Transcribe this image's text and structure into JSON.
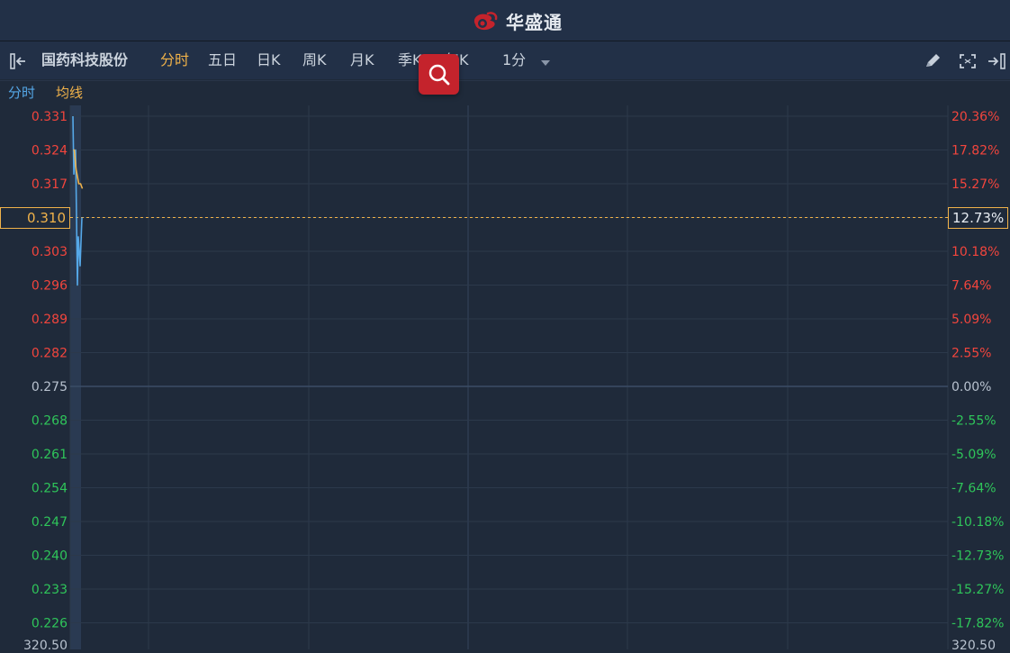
{
  "app": {
    "brand": "华盛通",
    "brand_color": "#c4232c"
  },
  "toolbar": {
    "stock_name": "国药科技股份",
    "tabs": [
      "分时",
      "五日",
      "日K",
      "周K",
      "月K",
      "季K",
      "年K"
    ],
    "active_tab": "分时",
    "interval": "1分",
    "icons": [
      "collapse-left-icon",
      "pencil-icon",
      "fullscreen-icon",
      "collapse-right-icon",
      "search-icon"
    ]
  },
  "legend": {
    "line1": "分时",
    "line2": "均线",
    "line1_color": "#55a8e8",
    "line2_color": "#f0b24a"
  },
  "chart_data": {
    "type": "line",
    "base_price": 0.275,
    "current_price": "0.310",
    "current_pct": "12.73%",
    "y_ticks": [
      {
        "price": "0.331",
        "pct": "20.36%",
        "dir": "up"
      },
      {
        "price": "0.324",
        "pct": "17.82%",
        "dir": "up"
      },
      {
        "price": "0.317",
        "pct": "15.27%",
        "dir": "up"
      },
      {
        "price": "0.310",
        "pct": "12.73%",
        "dir": "up"
      },
      {
        "price": "0.303",
        "pct": "10.18%",
        "dir": "up"
      },
      {
        "price": "0.296",
        "pct": "7.64%",
        "dir": "up"
      },
      {
        "price": "0.289",
        "pct": "5.09%",
        "dir": "up"
      },
      {
        "price": "0.282",
        "pct": "2.55%",
        "dir": "up"
      },
      {
        "price": "0.275",
        "pct": "0.00%",
        "dir": "flat"
      },
      {
        "price": "0.268",
        "pct": "-2.55%",
        "dir": "down"
      },
      {
        "price": "0.261",
        "pct": "-5.09%",
        "dir": "down"
      },
      {
        "price": "0.254",
        "pct": "-7.64%",
        "dir": "down"
      },
      {
        "price": "0.247",
        "pct": "-10.18%",
        "dir": "down"
      },
      {
        "price": "0.240",
        "pct": "-12.73%",
        "dir": "down"
      },
      {
        "price": "0.233",
        "pct": "-15.27%",
        "dir": "down"
      },
      {
        "price": "0.226",
        "pct": "-17.82%",
        "dir": "down"
      }
    ],
    "bottom_labels": {
      "left": "320.50",
      "right": "320.50"
    },
    "series": [
      {
        "name": "分时",
        "color": "#55a8e8",
        "points": [
          0.331,
          0.319,
          0.324,
          0.296,
          0.306,
          0.3,
          0.31
        ]
      },
      {
        "name": "均线",
        "color": "#f0b24a",
        "points": [
          0.324,
          0.324,
          0.32,
          0.318,
          0.317,
          0.317,
          0.316
        ]
      }
    ],
    "colors": {
      "up": "#f2453d",
      "down": "#2fc55a",
      "flat": "#b8c2cf",
      "grid": "#2c394b",
      "baseline": "#3b4d66"
    }
  }
}
